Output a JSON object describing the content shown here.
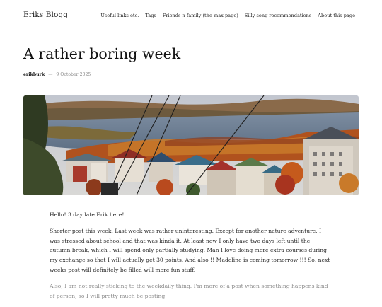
{
  "header": {
    "site_title": "Eriks Blogg",
    "nav": [
      {
        "label": "Useful links etc."
      },
      {
        "label": "Tags"
      },
      {
        "label": "Friends n family (the max page)"
      },
      {
        "label": "Silly song recommendations"
      },
      {
        "label": "About this page"
      }
    ]
  },
  "post": {
    "title": "A rather boring week",
    "author": "erikburk",
    "date": "9 October 2025",
    "paragraphs": [
      "Hello! 3 day late Erik here!",
      "Shorter post this week. Last week was rather uninteresting. Except for another nature adventure, I was stressed about school and that was kinda it. At least now I only have two days left until the autumn break, which I will spend only partially studying. Man I love doing more extra courses during my exchange so that I will actually get 30 points.  And also !! Madeline is coming tomorrow !!! So, next weeks post will definitely be filled will more fun stuff.",
      "Also, I am not really sticking to the weekdaily thing. I'm more of a post when something happens kind of person, so I will pretty much be posting"
    ]
  },
  "colors": {
    "sky": "#c9ccd3",
    "lake": "#6f8196",
    "foliage_orange": "#c8641e",
    "foliage_red": "#a8341f",
    "foliage_green": "#3f5a2e"
  }
}
